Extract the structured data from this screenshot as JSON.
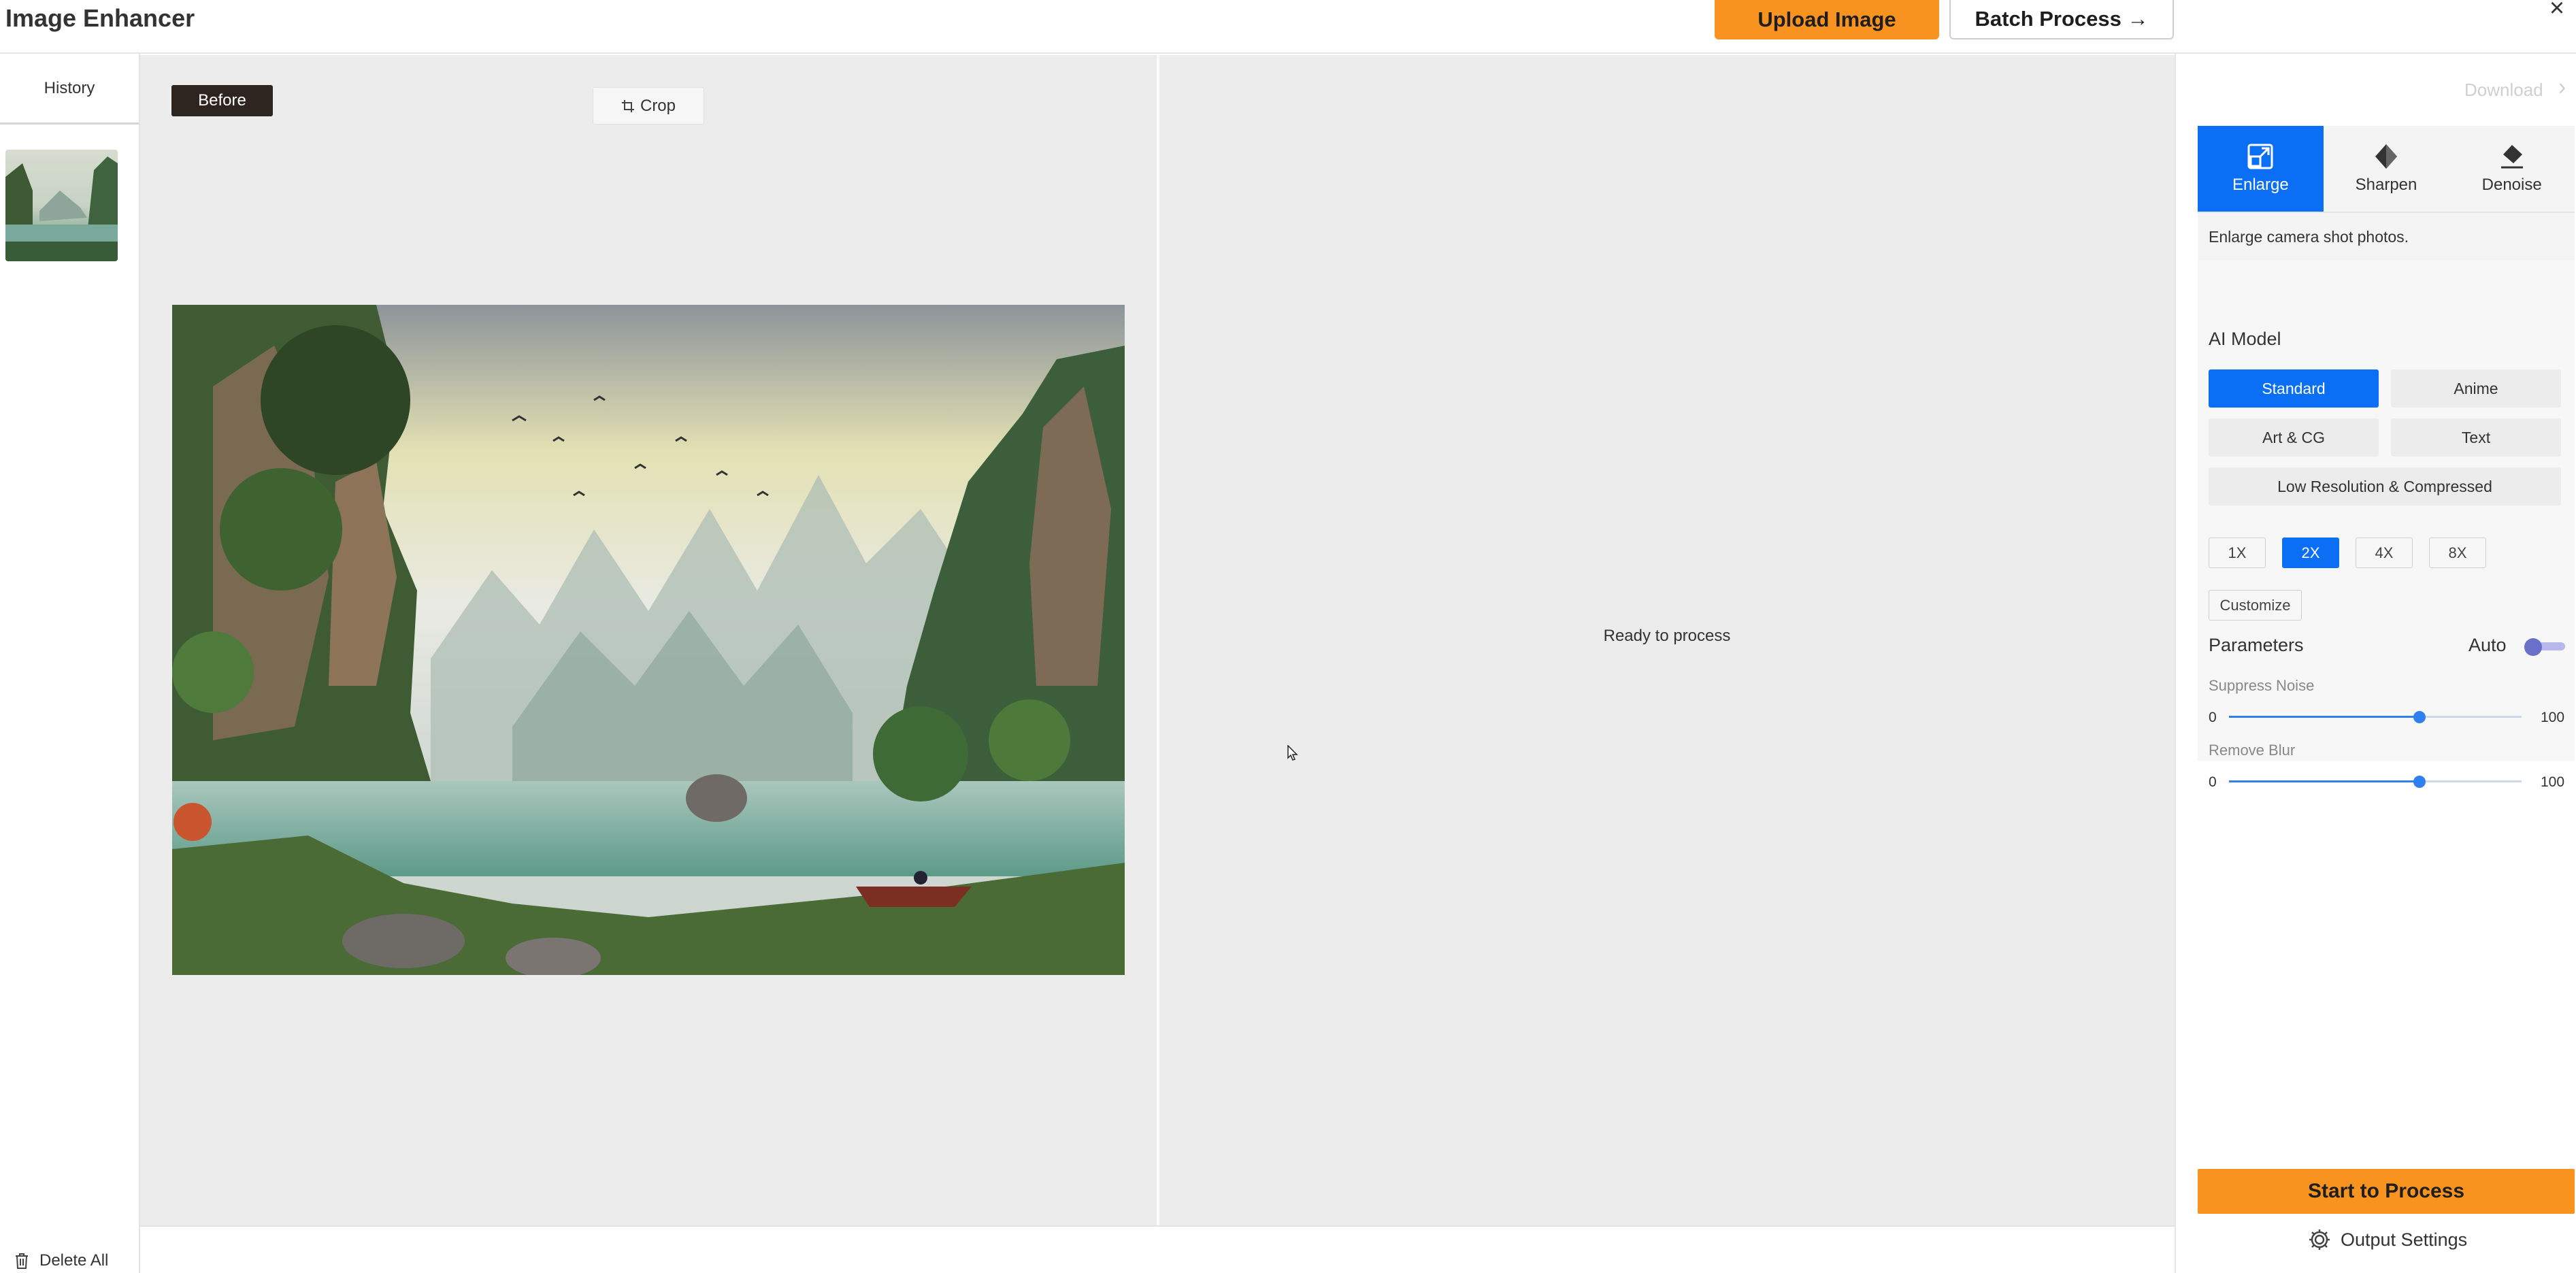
{
  "app": {
    "title": "Image Enhancer"
  },
  "header": {
    "upload_label": "Upload Image",
    "batch_label": "Batch Process →",
    "close_icon": "close-icon"
  },
  "sidebar": {
    "history_label": "History",
    "delete_all_label": "Delete All"
  },
  "preview": {
    "before_label": "Before",
    "crop_label": "Crop",
    "status_text": "Ready to process"
  },
  "right_panel": {
    "download_label": "Download",
    "tabs": [
      {
        "label": "Enlarge",
        "icon": "enlarge-icon",
        "active": true
      },
      {
        "label": "Sharpen",
        "icon": "sharpen-icon",
        "active": false
      },
      {
        "label": "Denoise",
        "icon": "eraser-icon",
        "active": false
      }
    ],
    "description": "Enlarge camera shot photos.",
    "ai_model_label": "AI Model",
    "models": [
      {
        "label": "Standard",
        "active": true
      },
      {
        "label": "Anime",
        "active": false
      },
      {
        "label": "Art & CG",
        "active": false
      },
      {
        "label": "Text",
        "active": false
      },
      {
        "label": "Low Resolution & Compressed",
        "active": false
      }
    ],
    "scales": [
      {
        "label": "1X",
        "active": false
      },
      {
        "label": "2X",
        "active": true
      },
      {
        "label": "4X",
        "active": false
      },
      {
        "label": "8X",
        "active": false
      }
    ],
    "customize_label": "Customize",
    "parameters_label": "Parameters",
    "auto_label": "Auto",
    "sliders": [
      {
        "label": "Suppress Noise",
        "min": "0",
        "max": "100",
        "value": 65
      },
      {
        "label": "Remove Blur",
        "min": "0",
        "max": "100",
        "value": 65
      }
    ],
    "start_label": "Start to Process",
    "output_settings_label": "Output Settings"
  },
  "colors": {
    "accent_blue": "#0a6ff5",
    "accent_orange": "#f7931e",
    "panel_gray": "#ececec"
  }
}
